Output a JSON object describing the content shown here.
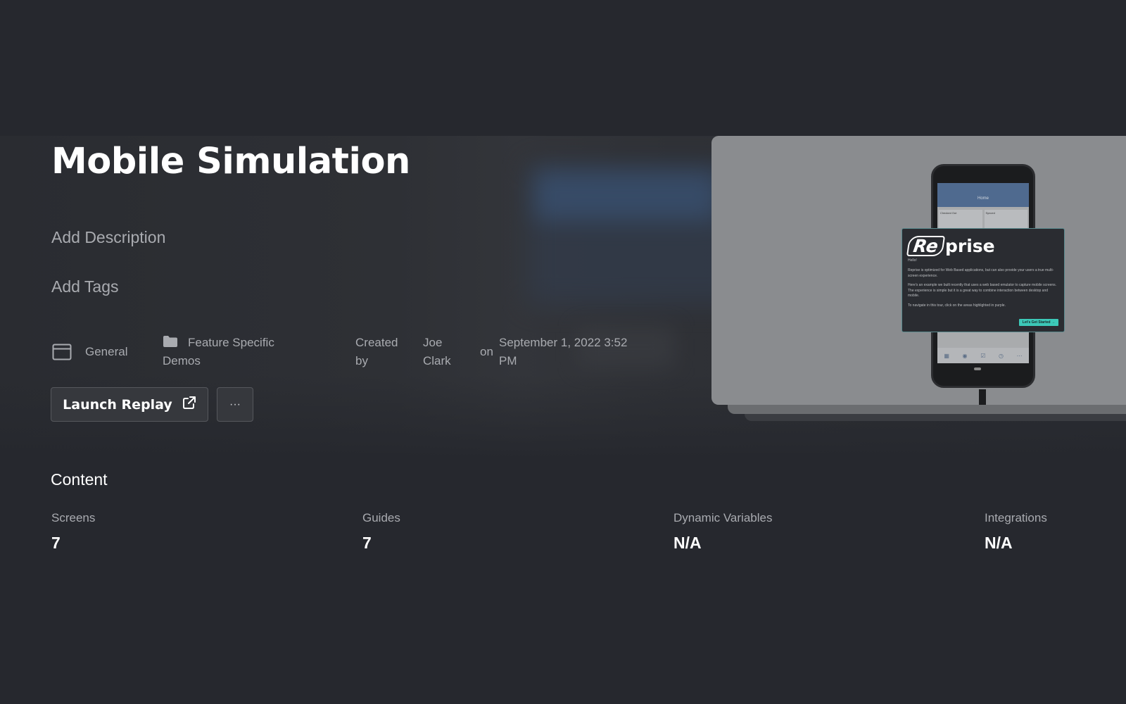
{
  "header": {
    "title": "Mobile Simulation",
    "add_description": "Add Description",
    "add_tags": "Add Tags"
  },
  "meta": {
    "workspace": "General",
    "folder": "Feature Specific Demos",
    "created_by_label": "Created by",
    "creator": "Joe Clark",
    "on_label": "on",
    "created_at": "September 1, 2022 3:52 PM"
  },
  "actions": {
    "launch_label": "Launch Replay",
    "more_label": "···"
  },
  "content": {
    "heading": "Content",
    "stats": [
      {
        "label": "Screens",
        "value": "7"
      },
      {
        "label": "Guides",
        "value": "7"
      },
      {
        "label": "Dynamic Variables",
        "value": "N/A"
      },
      {
        "label": "Integrations",
        "value": "N/A"
      }
    ]
  },
  "preview": {
    "phone_header": "Home",
    "tile_1": "Checked Out",
    "tile_2": "Synced",
    "logo_re": "Re",
    "logo_rest": "prise",
    "hello": "Hello!",
    "para_1": "Reprise is optimized for Web Based applications, but can also provide your users a true multi-screen experience.",
    "para_2": "Here's an example we built recently that uses a web based emulator to capture mobile screens. The experience is simple but it is a great way to combine interaction between desktop and mobile.",
    "para_3": "To navigate in this tour, click on the areas highlighted in purple.",
    "cta": "Let's Get Started →"
  },
  "colors": {
    "background": "#26282e",
    "accent_cta": "#3cc9b8",
    "muted_text": "#a9abb0"
  },
  "icons": {
    "workspace": "browser-window-icon",
    "folder": "folder-icon",
    "launch": "external-link-icon"
  }
}
